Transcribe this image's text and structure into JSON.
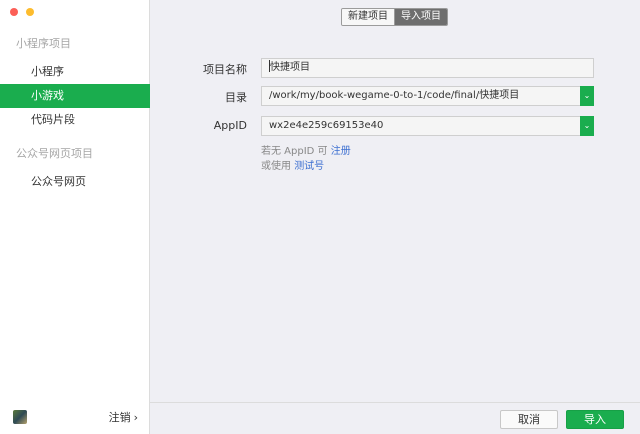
{
  "sidebar": {
    "sections": [
      {
        "title": "小程序项目"
      },
      {
        "title": "公众号网页项目"
      }
    ],
    "items": [
      {
        "label": "小程序"
      },
      {
        "label": "小游戏"
      },
      {
        "label": "代码片段"
      },
      {
        "label": "公众号网页"
      }
    ],
    "footer": {
      "logout_label": "注销",
      "logout_chevron": "›"
    }
  },
  "tabs": [
    {
      "label": "新建项目"
    },
    {
      "label": "导入项目"
    }
  ],
  "form": {
    "name": {
      "label": "项目名称",
      "value": "快捷项目"
    },
    "dir": {
      "label": "目录",
      "value": "/work/my/book-wegame-0-to-1/code/final/快捷项目"
    },
    "appid": {
      "label": "AppID",
      "value": "wx2e4e259c69153e40"
    },
    "hint1": {
      "prefix": "若无 AppID 可 ",
      "link": "注册"
    },
    "hint2": {
      "prefix": "或使用 ",
      "link": "测试号"
    }
  },
  "actions": {
    "cancel": "取消",
    "import": "导入"
  },
  "colors": {
    "accent": "#1aad4e",
    "link": "#3c6fd1"
  }
}
